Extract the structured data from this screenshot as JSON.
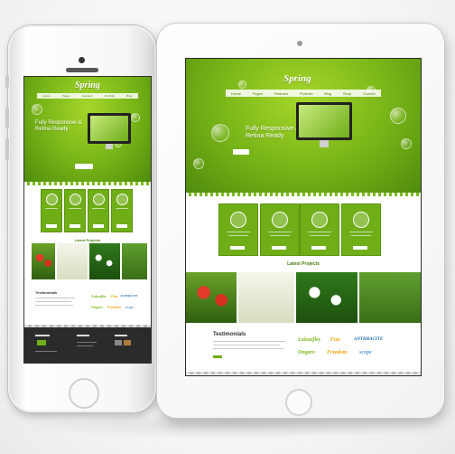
{
  "site": {
    "logo": "Spring",
    "nav": [
      "Home",
      "Pages",
      "Features",
      "Portfolio",
      "Blog",
      "Shop",
      "Contact"
    ],
    "hero_heading_line1": "Fully Responsive &",
    "hero_heading_line2": "Retina Ready",
    "section_latest": "Latest Projects",
    "section_testimonials": "Testimonials",
    "brands": [
      {
        "name": "Lukaufley",
        "color": "#7fb81e"
      },
      {
        "name": "Fun",
        "color": "#f0a30a"
      },
      {
        "name": "ANTHRACITE",
        "color": "#1b6aa8"
      },
      {
        "name": "Ongaro",
        "color": "#7fb81e"
      },
      {
        "name": "Freedom",
        "color": "#f0a30a"
      },
      {
        "name": "scope",
        "color": "#5a9ad6"
      }
    ],
    "accent": "#76b317"
  }
}
